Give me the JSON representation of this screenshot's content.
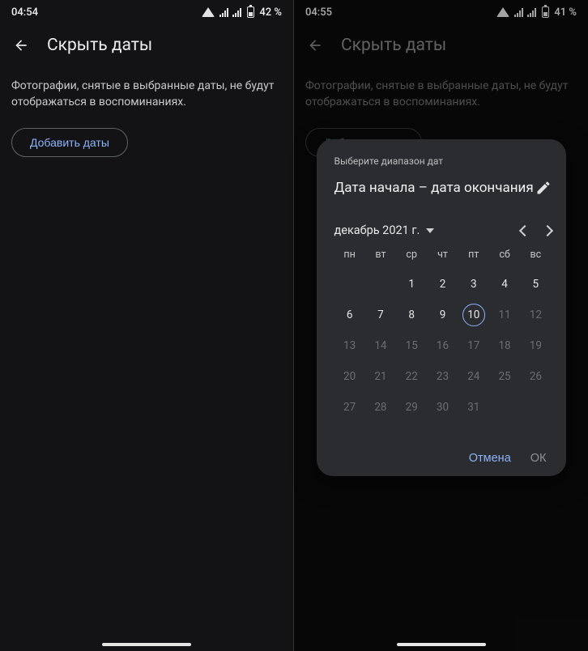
{
  "left": {
    "status": {
      "time": "04:54",
      "battery": "42 %"
    },
    "appbar": {
      "title": "Скрыть даты"
    },
    "description": "Фотографии, снятые в выбранные даты, не будут отображаться в воспоминаниях.",
    "add_button": "Добавить даты"
  },
  "right": {
    "status": {
      "time": "04:55",
      "battery": "41 %"
    },
    "appbar": {
      "title": "Скрыть даты"
    },
    "description": "Фотографии, снятые в выбранные даты, не будут отображаться в воспоминаниях.",
    "add_button": "Добавить даты",
    "modal": {
      "caption": "Выберите диапазон дат",
      "range_placeholder": "Дата начала – дата окончания",
      "month_label": "декабрь 2021 г.",
      "dow": [
        "пн",
        "вт",
        "ср",
        "чт",
        "пт",
        "сб",
        "вс"
      ],
      "weeks": [
        [
          {
            "n": "",
            "m": true
          },
          {
            "n": "",
            "m": true
          },
          {
            "n": "1"
          },
          {
            "n": "2"
          },
          {
            "n": "3"
          },
          {
            "n": "4"
          },
          {
            "n": "5"
          }
        ],
        [
          {
            "n": "6"
          },
          {
            "n": "7"
          },
          {
            "n": "8"
          },
          {
            "n": "9"
          },
          {
            "n": "10",
            "today": true
          },
          {
            "n": "11",
            "m": true
          },
          {
            "n": "12",
            "m": true
          }
        ],
        [
          {
            "n": "13",
            "m": true
          },
          {
            "n": "14",
            "m": true
          },
          {
            "n": "15",
            "m": true
          },
          {
            "n": "16",
            "m": true
          },
          {
            "n": "17",
            "m": true
          },
          {
            "n": "18",
            "m": true
          },
          {
            "n": "19",
            "m": true
          }
        ],
        [
          {
            "n": "20",
            "m": true
          },
          {
            "n": "21",
            "m": true
          },
          {
            "n": "22",
            "m": true
          },
          {
            "n": "23",
            "m": true
          },
          {
            "n": "24",
            "m": true
          },
          {
            "n": "25",
            "m": true
          },
          {
            "n": "26",
            "m": true
          }
        ],
        [
          {
            "n": "27",
            "m": true
          },
          {
            "n": "28",
            "m": true
          },
          {
            "n": "29",
            "m": true
          },
          {
            "n": "30",
            "m": true
          },
          {
            "n": "31",
            "m": true
          },
          {
            "n": "",
            "m": true
          },
          {
            "n": "",
            "m": true
          }
        ]
      ],
      "actions": {
        "cancel": "Отмена",
        "ok": "ОК"
      }
    }
  }
}
